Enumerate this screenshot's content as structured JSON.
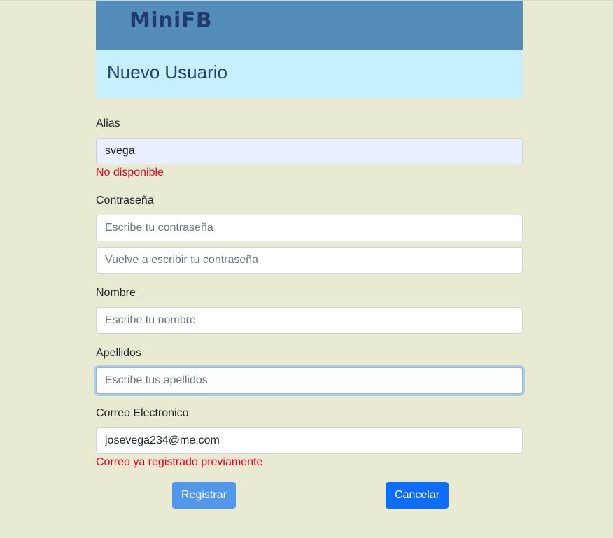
{
  "brand": {
    "logo": "MiniFB"
  },
  "page": {
    "title": "Nuevo Usuario"
  },
  "form": {
    "alias": {
      "label": "Alias",
      "value": "svega",
      "error": "No disponible"
    },
    "password": {
      "label": "Contraseña",
      "placeholder": "Escribe tu contraseña",
      "confirm_placeholder": "Vuelve a escribir tu contraseña"
    },
    "first_name": {
      "label": "Nombre",
      "placeholder": "Escribe tu nombre"
    },
    "last_name": {
      "label": "Apellidos",
      "placeholder": "Escribe tus apellidos"
    },
    "email": {
      "label": "Correo Electronico",
      "value": "josevega234@me.com",
      "error": "Correo ya registrado previamente"
    }
  },
  "actions": {
    "register_label": "Registrar",
    "cancel_label": "Cancelar"
  },
  "colors": {
    "page_background": "#e8ebd2",
    "brand_bar": "#558dba",
    "title_bar": "#c7f0fe",
    "error_text": "#e8001c",
    "primary_button": "#0d6efd",
    "disabled_button": "#5198ed"
  }
}
